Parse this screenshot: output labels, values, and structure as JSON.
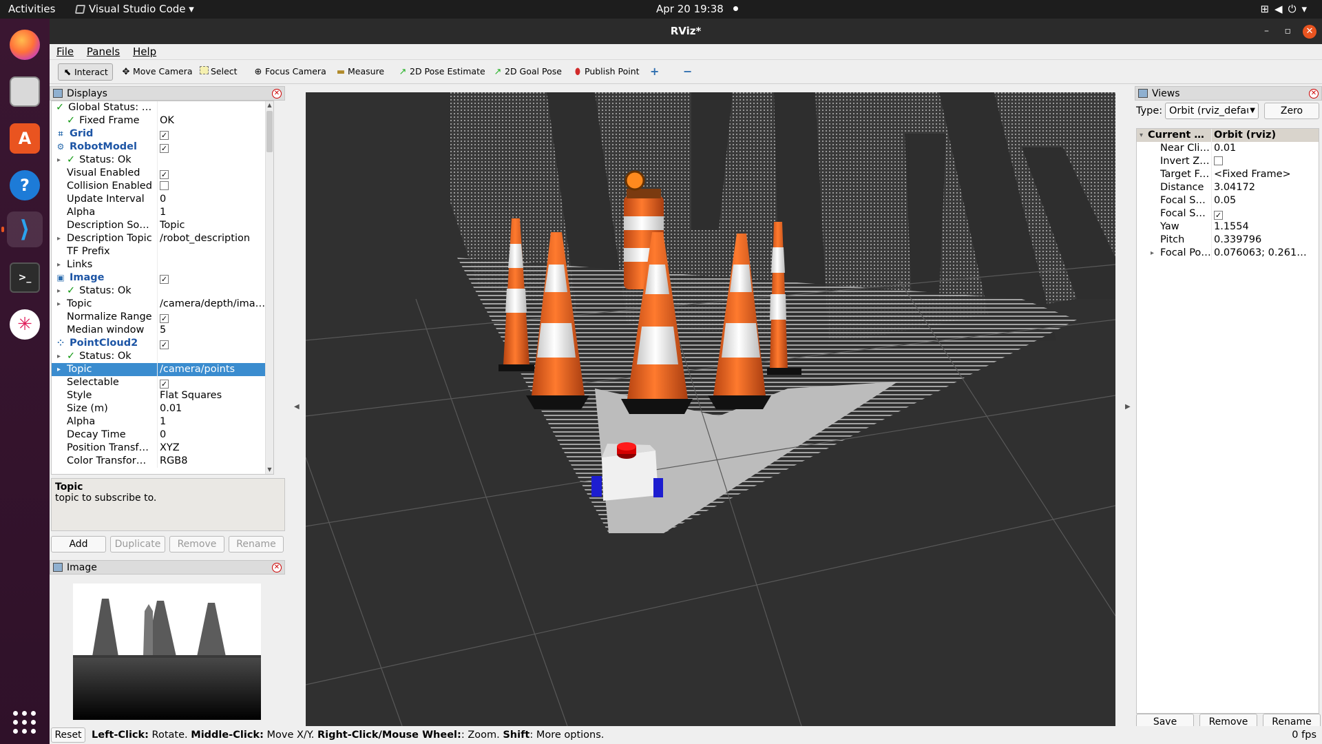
{
  "topbar": {
    "activities": "Activities",
    "app_name": "Visual Studio Code",
    "clock": "Apr 20  19:38",
    "app_menu_arrow": "▾"
  },
  "window": {
    "title": "RViz*",
    "minimize": "–",
    "maximize": "▫",
    "close": "✕"
  },
  "menu": {
    "file": "File",
    "panels": "Panels",
    "help": "Help"
  },
  "toolbar": {
    "interact": "Interact",
    "move_camera": "Move Camera",
    "select": "Select",
    "focus_camera": "Focus Camera",
    "measure": "Measure",
    "pose_estimate": "2D Pose Estimate",
    "goal_pose": "2D Goal Pose",
    "publish_point": "Publish Point"
  },
  "displays": {
    "title": "Displays",
    "rows": [
      {
        "indent": 0,
        "twisty": "",
        "icon": "check",
        "name": "Global Status: Ok",
        "value": "",
        "kind": "status"
      },
      {
        "indent": 1,
        "twisty": "",
        "icon": "check",
        "name": "Fixed Frame",
        "value": "OK",
        "kind": "status"
      },
      {
        "indent": 0,
        "twisty": "",
        "icon": "grid",
        "name": "Grid",
        "value": "",
        "checked": true,
        "kind": "plugin"
      },
      {
        "indent": 0,
        "twisty": "",
        "icon": "robot",
        "name": "RobotModel",
        "value": "",
        "checked": true,
        "kind": "plugin"
      },
      {
        "indent": 1,
        "twisty": "▸",
        "icon": "check",
        "name": "Status: Ok",
        "value": "",
        "kind": "status"
      },
      {
        "indent": 1,
        "twisty": "",
        "icon": "",
        "name": "Visual Enabled",
        "value": "",
        "checked": true,
        "kind": "prop"
      },
      {
        "indent": 1,
        "twisty": "",
        "icon": "",
        "name": "Collision Enabled",
        "value": "",
        "checked": false,
        "kind": "prop"
      },
      {
        "indent": 1,
        "twisty": "",
        "icon": "",
        "name": "Update Interval",
        "value": "0",
        "kind": "prop"
      },
      {
        "indent": 1,
        "twisty": "",
        "icon": "",
        "name": "Alpha",
        "value": "1",
        "kind": "prop"
      },
      {
        "indent": 1,
        "twisty": "",
        "icon": "",
        "name": "Description Sou…",
        "value": "Topic",
        "kind": "prop"
      },
      {
        "indent": 1,
        "twisty": "▸",
        "icon": "",
        "name": "Description Topic",
        "value": "/robot_description",
        "kind": "prop"
      },
      {
        "indent": 1,
        "twisty": "",
        "icon": "",
        "name": "TF Prefix",
        "value": "",
        "kind": "prop"
      },
      {
        "indent": 1,
        "twisty": "▸",
        "icon": "",
        "name": "Links",
        "value": "",
        "kind": "prop"
      },
      {
        "indent": 0,
        "twisty": "",
        "icon": "image",
        "name": "Image",
        "value": "",
        "checked": true,
        "kind": "plugin"
      },
      {
        "indent": 1,
        "twisty": "▸",
        "icon": "check",
        "name": "Status: Ok",
        "value": "",
        "kind": "status"
      },
      {
        "indent": 1,
        "twisty": "▸",
        "icon": "",
        "name": "Topic",
        "value": "/camera/depth/imag…",
        "kind": "prop"
      },
      {
        "indent": 1,
        "twisty": "",
        "icon": "",
        "name": "Normalize Range",
        "value": "",
        "checked": true,
        "kind": "prop"
      },
      {
        "indent": 1,
        "twisty": "",
        "icon": "",
        "name": "Median window",
        "value": "5",
        "kind": "prop"
      },
      {
        "indent": 0,
        "twisty": "",
        "icon": "cloud",
        "name": "PointCloud2",
        "value": "",
        "checked": true,
        "kind": "plugin"
      },
      {
        "indent": 1,
        "twisty": "▸",
        "icon": "check",
        "name": "Status: Ok",
        "value": "",
        "kind": "status"
      },
      {
        "indent": 1,
        "twisty": "▸",
        "icon": "",
        "name": "Topic",
        "value": "/camera/points",
        "kind": "prop",
        "selected": true
      },
      {
        "indent": 1,
        "twisty": "",
        "icon": "",
        "name": "Selectable",
        "value": "",
        "checked": true,
        "kind": "prop"
      },
      {
        "indent": 1,
        "twisty": "",
        "icon": "",
        "name": "Style",
        "value": "Flat Squares",
        "kind": "prop"
      },
      {
        "indent": 1,
        "twisty": "",
        "icon": "",
        "name": "Size (m)",
        "value": "0.01",
        "kind": "prop"
      },
      {
        "indent": 1,
        "twisty": "",
        "icon": "",
        "name": "Alpha",
        "value": "1",
        "kind": "prop"
      },
      {
        "indent": 1,
        "twisty": "",
        "icon": "",
        "name": "Decay Time",
        "value": "0",
        "kind": "prop"
      },
      {
        "indent": 1,
        "twisty": "",
        "icon": "",
        "name": "Position Transf…",
        "value": "XYZ",
        "kind": "prop"
      },
      {
        "indent": 1,
        "twisty": "",
        "icon": "",
        "name": "Color Transfor…",
        "value": "RGB8",
        "kind": "prop"
      }
    ],
    "description_title": "Topic",
    "description_text": "topic to subscribe to.",
    "buttons": {
      "add": "Add",
      "duplicate": "Duplicate",
      "remove": "Remove",
      "rename": "Rename"
    }
  },
  "image_panel": {
    "title": "Image"
  },
  "views": {
    "title": "Views",
    "type_label": "Type:",
    "type_value": "Orbit (rviz_defau",
    "zero_label": "Zero",
    "rows": [
      {
        "twisty": "▾",
        "name": "Current View",
        "value": "Orbit (rviz)",
        "header": true
      },
      {
        "twisty": "",
        "name": "Near Clip …",
        "value": "0.01"
      },
      {
        "twisty": "",
        "name": "Invert Z Axis",
        "value": "",
        "checked": false
      },
      {
        "twisty": "",
        "name": "Target Fra…",
        "value": "<Fixed Frame>"
      },
      {
        "twisty": "",
        "name": "Distance",
        "value": "3.04172"
      },
      {
        "twisty": "",
        "name": "Focal Shap…",
        "value": "0.05"
      },
      {
        "twisty": "",
        "name": "Focal Shap…",
        "value": "",
        "checked": true
      },
      {
        "twisty": "",
        "name": "Yaw",
        "value": "1.1554"
      },
      {
        "twisty": "",
        "name": "Pitch",
        "value": "0.339796"
      },
      {
        "twisty": "▸",
        "name": "Focal Point",
        "value": "0.076063; 0.261…"
      }
    ],
    "buttons": {
      "save": "Save",
      "remove": "Remove",
      "rename": "Rename"
    }
  },
  "status": {
    "reset": "Reset",
    "hint_left_label": "Left-Click:",
    "hint_left": " Rotate. ",
    "hint_middle_label": "Middle-Click:",
    "hint_middle": " Move X/Y. ",
    "hint_right_label": "Right-Click/Mouse Wheel:",
    "hint_right": ": Zoom. ",
    "hint_shift_label": "Shift",
    "hint_shift": ": More options.",
    "fps": "0 fps"
  },
  "colors": {
    "selection": "#3a8ccf",
    "plugin_text": "#1d55a5",
    "status_ok": "#149a14",
    "cone_orange": "#e8601c",
    "ubuntu_accent": "#e95420"
  }
}
